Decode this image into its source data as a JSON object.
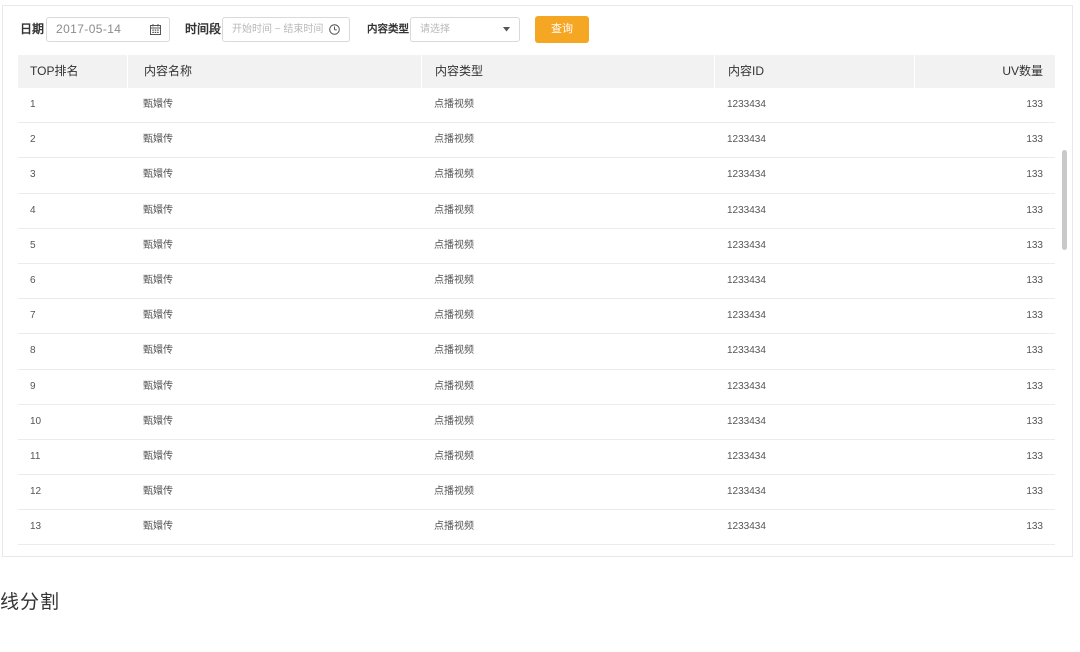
{
  "filters": {
    "date": {
      "label": "日期",
      "value": "2017-05-14",
      "icon": "calendar-icon"
    },
    "time_range": {
      "label": "时间段",
      "placeholder": "开始时间 ~ 结束时间",
      "icon": "clock-icon"
    },
    "content_type": {
      "label": "内容类型",
      "placeholder": "请选择",
      "icon": "caret-down-icon"
    },
    "query_button": {
      "label": "查询"
    }
  },
  "table": {
    "columns": [
      "TOP排名",
      "内容名称",
      "内容类型",
      "内容ID",
      "UV数量"
    ],
    "rows": [
      {
        "rank": "1",
        "name": "甄嬛传",
        "type": "点播视频",
        "id": "1233434",
        "uv": "133"
      },
      {
        "rank": "2",
        "name": "甄嬛传",
        "type": "点播视频",
        "id": "1233434",
        "uv": "133"
      },
      {
        "rank": "3",
        "name": "甄嬛传",
        "type": "点播视频",
        "id": "1233434",
        "uv": "133"
      },
      {
        "rank": "4",
        "name": "甄嬛传",
        "type": "点播视频",
        "id": "1233434",
        "uv": "133"
      },
      {
        "rank": "5",
        "name": "甄嬛传",
        "type": "点播视频",
        "id": "1233434",
        "uv": "133"
      },
      {
        "rank": "6",
        "name": "甄嬛传",
        "type": "点播视频",
        "id": "1233434",
        "uv": "133"
      },
      {
        "rank": "7",
        "name": "甄嬛传",
        "type": "点播视频",
        "id": "1233434",
        "uv": "133"
      },
      {
        "rank": "8",
        "name": "甄嬛传",
        "type": "点播视频",
        "id": "1233434",
        "uv": "133"
      },
      {
        "rank": "9",
        "name": "甄嬛传",
        "type": "点播视频",
        "id": "1233434",
        "uv": "133"
      },
      {
        "rank": "10",
        "name": "甄嬛传",
        "type": "点播视频",
        "id": "1233434",
        "uv": "133"
      },
      {
        "rank": "11",
        "name": "甄嬛传",
        "type": "点播视频",
        "id": "1233434",
        "uv": "133"
      },
      {
        "rank": "12",
        "name": "甄嬛传",
        "type": "点播视频",
        "id": "1233434",
        "uv": "133"
      },
      {
        "rank": "13",
        "name": "甄嬛传",
        "type": "点播视频",
        "id": "1233434",
        "uv": "133"
      }
    ]
  },
  "section_title": "线分割",
  "colors": {
    "accent": "#f5a623",
    "header_bg": "#f2f2f2",
    "border": "#e8e8e8"
  }
}
